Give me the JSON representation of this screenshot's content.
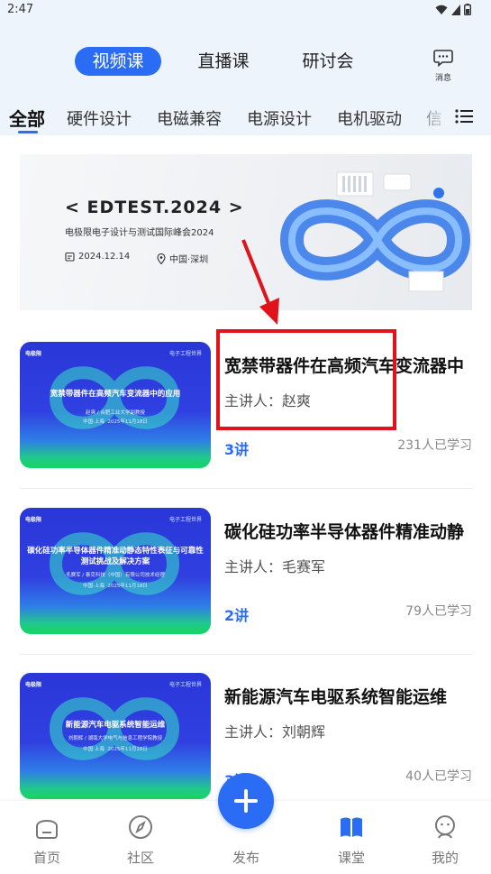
{
  "status_bar": {
    "time": "2:47"
  },
  "type_tabs": [
    {
      "label": "视频课",
      "active": true
    },
    {
      "label": "直播课",
      "active": false
    },
    {
      "label": "研讨会",
      "active": false
    }
  ],
  "message": {
    "label": "消息",
    "icon": "chat-icon"
  },
  "categories": [
    {
      "label": "全部",
      "active": true
    },
    {
      "label": "硬件设计"
    },
    {
      "label": "电磁兼容"
    },
    {
      "label": "电源设计"
    },
    {
      "label": "电机驱动"
    },
    {
      "label": "信"
    }
  ],
  "banner": {
    "title": "< EDTEST.2024 >",
    "subtitle": "电极限电子设计与测试国际峰会2024",
    "date": "2024.12.14",
    "location": "中国·深圳"
  },
  "courses": [
    {
      "title": "宽禁带器件在高频汽车变流器中",
      "thumb_title": "宽禁带器件在高频汽车变流器中的应用",
      "thumb_speaker": "赵爽 / 合肥工业大学副教授",
      "speaker": "主讲人：赵爽",
      "lectures": "3讲",
      "learners": "231人已学习"
    },
    {
      "title": "碳化硅功率半导体器件精准动静",
      "thumb_title": "碳化硅功率半导体器件精准动静态特性表征与可靠性测试挑战及解决方案",
      "thumb_speaker": "毛赛军 / 泰克科技（中国）有限公司技术经理",
      "speaker": "主讲人：毛赛军",
      "lectures": "2讲",
      "learners": "79人已学习"
    },
    {
      "title": "新能源汽车电驱系统智能运维",
      "thumb_title": "新能源汽车电驱系统智能运维",
      "thumb_speaker": "刘朝辉 / 湖南大学电气与信息工程学院教授",
      "speaker": "主讲人：刘朝辉",
      "lectures": "3讲",
      "learners": "40人已学习"
    }
  ],
  "thumb_brand": "电极限",
  "thumb_org": "电子工程世界",
  "thumb_date": "2025年11月18日",
  "thumb_place": "中国·上海",
  "bottom_nav": [
    {
      "label": "首页",
      "icon": "home-icon"
    },
    {
      "label": "社区",
      "icon": "compass-icon"
    },
    {
      "label": "发布",
      "icon": "plus-icon"
    },
    {
      "label": "课堂",
      "icon": "book-icon",
      "active": true
    },
    {
      "label": "我的",
      "icon": "profile-icon"
    }
  ],
  "colors": {
    "accent": "#2a6cf3",
    "annotation": "#e0131b",
    "header_bg": "#eef4fc"
  }
}
